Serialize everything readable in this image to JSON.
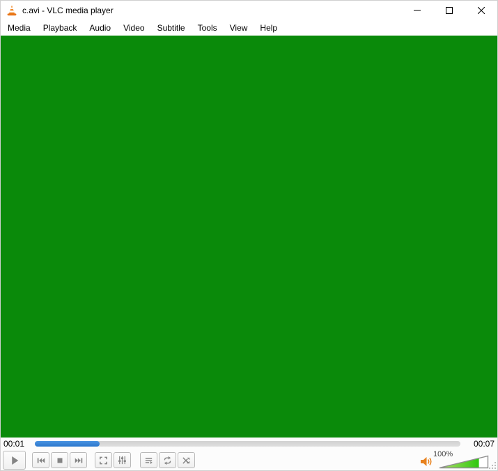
{
  "window": {
    "title": "c.avi - VLC media player",
    "app_icon": "vlc-cone-icon",
    "controls": [
      "minimize",
      "maximize",
      "close"
    ]
  },
  "menu_bar": {
    "items": [
      "Media",
      "Playback",
      "Audio",
      "Video",
      "Subtitle",
      "Tools",
      "View",
      "Help"
    ]
  },
  "video_area": {
    "background_color": "#0a8a0a",
    "state": "playing-green-frame"
  },
  "seek": {
    "elapsed": "00:01",
    "total": "00:07",
    "progress_percent": 15.3,
    "progress_color": "#2f7fd6",
    "track_color": "#d8d8d8"
  },
  "transport": {
    "buttons": [
      "play-button",
      "previous-button",
      "stop-button",
      "next-button",
      "fullscreen-button",
      "extended-settings-button",
      "playlist-button",
      "loop-button",
      "shuffle-button"
    ],
    "icon_color": "#848484"
  },
  "volume": {
    "label": "100%",
    "level_percent": 80,
    "speaker_icon": "speaker-orange-icon",
    "fill_gradient": [
      "#b5e06b",
      "#2ec70e"
    ]
  }
}
